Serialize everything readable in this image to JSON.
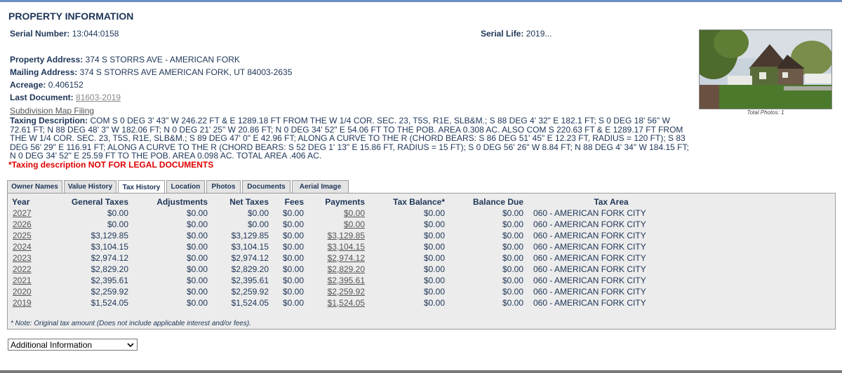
{
  "page_title": "PROPERTY INFORMATION",
  "serial_number": {
    "label": "Serial Number:",
    "value": "13:044:0158"
  },
  "serial_life": {
    "label": "Serial Life:",
    "value": "2019..."
  },
  "property_address": {
    "label": "Property Address:",
    "value": "374 S STORRS AVE - AMERICAN FORK"
  },
  "mailing_address": {
    "label": "Mailing Address:",
    "value": "374 S STORRS AVE AMERICAN FORK, UT 84003-2635"
  },
  "acreage": {
    "label": "Acreage:",
    "value": "0.406152"
  },
  "last_document": {
    "label": "Last Document:",
    "value": "81603-2019"
  },
  "subdivision_link": "Subdivision Map Filing",
  "taxing_description": {
    "label": "Taxing Description:",
    "value": "COM S 0 DEG 3' 43\" W 246.22 FT & E 1289.18 FT FROM THE W 1/4 COR. SEC. 23, T5S, R1E, SLB&M.; S 88 DEG 4' 32\" E 182.1 FT; S 0 DEG 18' 56\" W 72.61 FT; N 88 DEG 48' 3\" W 182.06 FT; N 0 DEG 21' 25\" W 20.86 FT; N 0 DEG 34' 52\" E 54.06 FT TO THE POB. AREA 0.308 AC. ALSO COM S 220.63 FT & E 1289.17 FT FROM THE W 1/4 COR. SEC. 23, T5S, R1E, SLB&M.; S 89 DEG 47' 0\" E 42.96 FT; ALONG A CURVE TO THE R (CHORD BEARS: S 86 DEG 51' 45\" E 12.23 FT, RADIUS = 120 FT); S 83 DEG 56' 29\" E 116.91 FT; ALONG A CURVE TO THE R (CHORD BEARS: S 52 DEG 1' 13\" E 15.86 FT, RADIUS = 15 FT); S 0 DEG 56' 26\" W 8.84 FT; N 88 DEG 4' 34\" W 184.15 FT; N 0 DEG 34' 52\" E 25.59 FT TO THE POB. AREA 0.098 AC. TOTAL AREA .406 AC."
  },
  "warning": "*Taxing description NOT FOR LEGAL DOCUMENTS",
  "photo_caption": "Total Photos: 1",
  "tabs": [
    {
      "label": "Owner Names"
    },
    {
      "label": "Value History"
    },
    {
      "label": "Tax History"
    },
    {
      "label": "Location"
    },
    {
      "label": "Photos"
    },
    {
      "label": "Documents"
    },
    {
      "label": "Aerial Image"
    }
  ],
  "active_tab": "Tax History",
  "table": {
    "headers": [
      "Year",
      "General Taxes",
      "Adjustments",
      "Net Taxes",
      "Fees",
      "Payments",
      "Tax Balance*",
      "Balance Due",
      "Tax Area"
    ],
    "rows": [
      [
        "2027",
        "$0.00",
        "$0.00",
        "$0.00",
        "$0.00",
        "$0.00",
        "$0.00",
        "$0.00",
        "060 - AMERICAN FORK CITY"
      ],
      [
        "2026",
        "$0.00",
        "$0.00",
        "$0.00",
        "$0.00",
        "$0.00",
        "$0.00",
        "$0.00",
        "060 - AMERICAN FORK CITY"
      ],
      [
        "2025",
        "$3,129.85",
        "$0.00",
        "$3,129.85",
        "$0.00",
        "$3,129.85",
        "$0.00",
        "$0.00",
        "060 - AMERICAN FORK CITY"
      ],
      [
        "2024",
        "$3,104.15",
        "$0.00",
        "$3,104.15",
        "$0.00",
        "$3,104.15",
        "$0.00",
        "$0.00",
        "060 - AMERICAN FORK CITY"
      ],
      [
        "2023",
        "$2,974.12",
        "$0.00",
        "$2,974.12",
        "$0.00",
        "$2,974.12",
        "$0.00",
        "$0.00",
        "060 - AMERICAN FORK CITY"
      ],
      [
        "2022",
        "$2,829.20",
        "$0.00",
        "$2,829.20",
        "$0.00",
        "$2,829.20",
        "$0.00",
        "$0.00",
        "060 - AMERICAN FORK CITY"
      ],
      [
        "2021",
        "$2,395.61",
        "$0.00",
        "$2,395.61",
        "$0.00",
        "$2,395.61",
        "$0.00",
        "$0.00",
        "060 - AMERICAN FORK CITY"
      ],
      [
        "2020",
        "$2,259.92",
        "$0.00",
        "$2,259.92",
        "$0.00",
        "$2,259.92",
        "$0.00",
        "$0.00",
        "060 - AMERICAN FORK CITY"
      ],
      [
        "2019",
        "$1,524.05",
        "$0.00",
        "$1,524.05",
        "$0.00",
        "$1,524.05",
        "$0.00",
        "$0.00",
        "060 - AMERICAN FORK CITY"
      ]
    ],
    "note": "* Note: Original tax amount (Does not include applicable interest and/or fees)."
  },
  "additional_info_select": {
    "selected": "Additional Information"
  },
  "colors": {
    "heading": "#1d3557",
    "warning": "#e00000",
    "panel_bg": "#ececec",
    "top_bar": "#6c8ebf"
  }
}
